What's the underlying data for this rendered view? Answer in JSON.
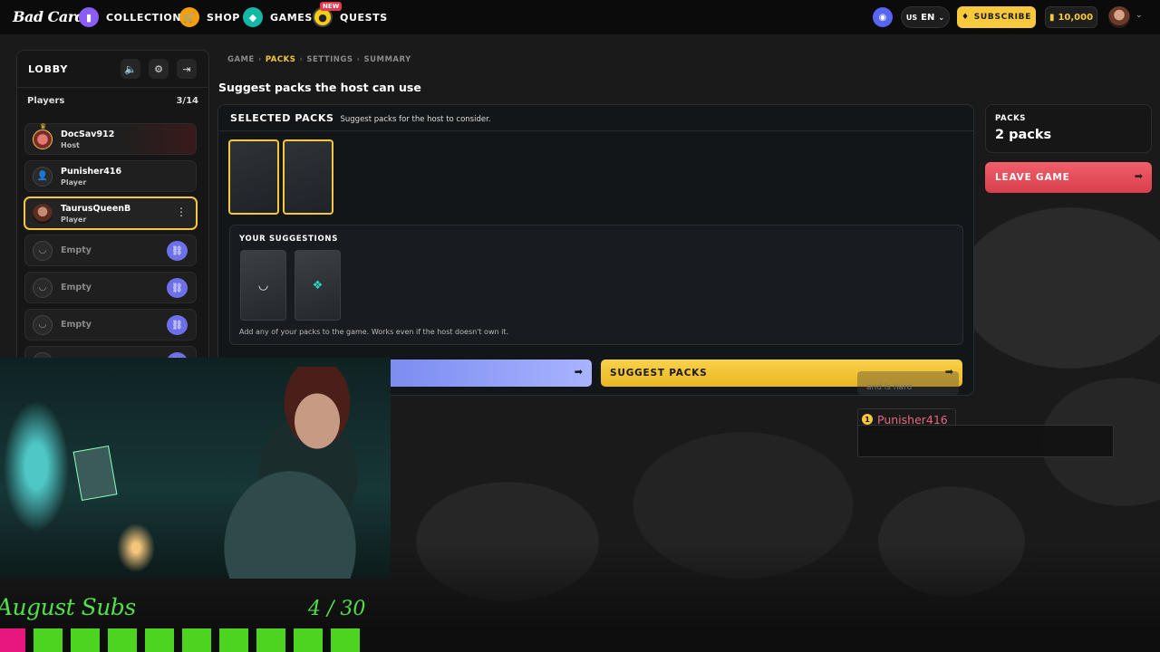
{
  "nav": {
    "logo": "Bad Cards",
    "items": [
      {
        "label": "COLLECTION",
        "icon": "cards-icon"
      },
      {
        "label": "SHOP",
        "icon": "cart-icon"
      },
      {
        "label": "GAMES",
        "icon": "games-icon"
      },
      {
        "label": "QUESTS",
        "icon": "quests-icon",
        "badge": "NEW"
      }
    ],
    "lang_region": "US",
    "lang_code": "EN",
    "subscribe_label": "SUBSCRIBE",
    "coins": "10,000"
  },
  "lobby": {
    "title": "LOBBY",
    "players_label": "Players",
    "players_count": "3/14",
    "players": [
      {
        "name": "DocSav912",
        "role": "Host"
      },
      {
        "name": "Punisher416",
        "role": "Player"
      },
      {
        "name": "TaurusQueenB",
        "role": "Player"
      }
    ],
    "empty_label": "Empty"
  },
  "breadcrumb": [
    "GAME",
    "PACKS",
    "SETTINGS",
    "SUMMARY"
  ],
  "page_title": "Suggest packs the host can use",
  "selected": {
    "title": "SELECTED PACKS",
    "subtitle": "Suggest packs for the host to consider."
  },
  "suggestions": {
    "title": "YOUR SUGGESTIONS",
    "note": "Add any of your packs to the game. Works even if the host doesn't own it."
  },
  "buttons": {
    "suggest": "SUGGEST PACKS",
    "leave": "LEAVE GAME"
  },
  "packs_card": {
    "label": "PACKS",
    "value": "2 packs"
  },
  "chat": {
    "ghost_text": "and is hard",
    "user": "Punisher416"
  },
  "overlay": {
    "subs_title": "August Subs",
    "subs_count": "4 / 30"
  },
  "colors": {
    "accent": "#f4c83a",
    "invite": "#6d70e8",
    "leave": "#d93e4b",
    "subs": "#4dd41e"
  }
}
